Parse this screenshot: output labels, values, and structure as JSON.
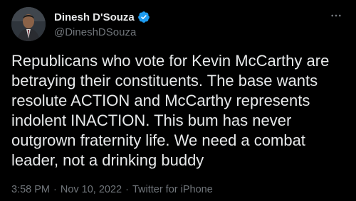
{
  "author": {
    "display_name": "Dinesh D'Souza",
    "handle": "@DineshDSouza",
    "verified": true
  },
  "tweet": {
    "text": "Republicans who vote for Kevin McCarthy are betraying their constituents. The base wants resolute ACTION and McCarthy represents indolent INACTION. This bum has never outgrown fraternity life. We need a combat leader, not a drinking buddy",
    "time": "3:58 PM",
    "date": "Nov 10, 2022",
    "source": "Twitter for iPhone",
    "separator": "·"
  },
  "icons": {
    "more": "more-dots-icon",
    "verified": "verified-badge-icon"
  },
  "colors": {
    "background": "#000000",
    "text_primary": "#e7e9ea",
    "text_secondary": "#71767b",
    "verified": "#1d9bf0"
  }
}
